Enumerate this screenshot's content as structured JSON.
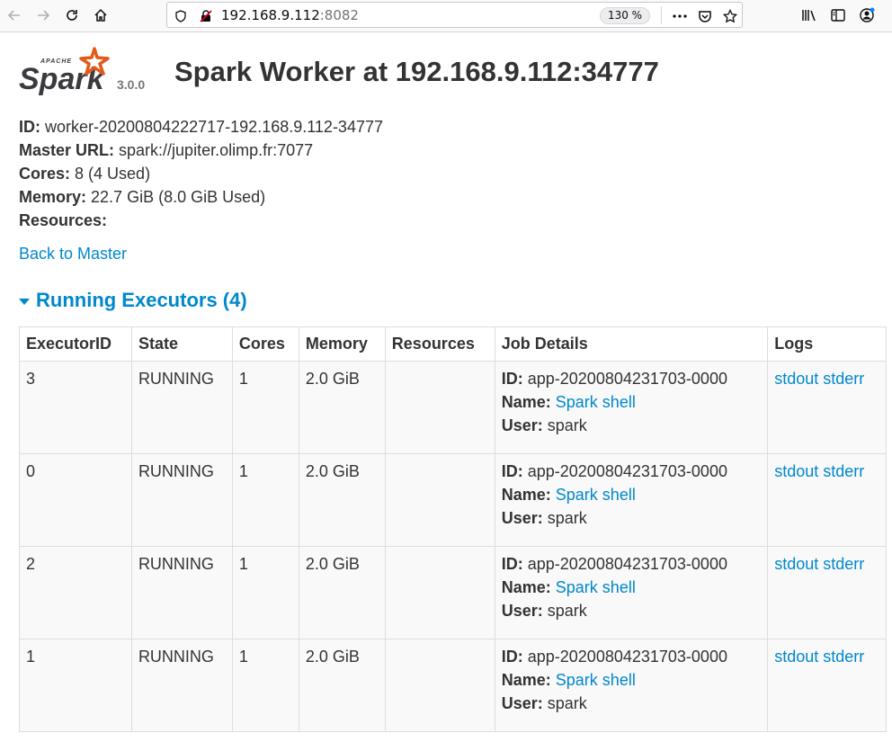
{
  "browser": {
    "url_host": "192.168.9.112",
    "url_port": ":8082",
    "zoom": "130 %"
  },
  "header": {
    "logo_text": "Spark",
    "logo_small": "APACHE",
    "version": "3.0.0",
    "title": "Spark Worker at 192.168.9.112:34777"
  },
  "info": {
    "id_label": "ID:",
    "id_value": "worker-20200804222717-192.168.9.112-34777",
    "master_label": "Master URL:",
    "master_value": "spark://jupiter.olimp.fr:7077",
    "cores_label": "Cores:",
    "cores_value": "8 (4 Used)",
    "memory_label": "Memory:",
    "memory_value": "22.7 GiB (8.0 GiB Used)",
    "resources_label": "Resources:",
    "resources_value": ""
  },
  "back_link": "Back to Master",
  "executors": {
    "header": "Running Executors (4)",
    "columns": [
      "ExecutorID",
      "State",
      "Cores",
      "Memory",
      "Resources",
      "Job Details",
      "Logs"
    ],
    "job_labels": {
      "id": "ID:",
      "name": "Name:",
      "user": "User:"
    },
    "rows": [
      {
        "id": "3",
        "state": "RUNNING",
        "cores": "1",
        "memory": "2.0 GiB",
        "resources": "",
        "app_id": "app-20200804231703-0000",
        "app_name": "Spark shell",
        "user": "spark",
        "stdout": "stdout",
        "stderr": "stderr"
      },
      {
        "id": "0",
        "state": "RUNNING",
        "cores": "1",
        "memory": "2.0 GiB",
        "resources": "",
        "app_id": "app-20200804231703-0000",
        "app_name": "Spark shell",
        "user": "spark",
        "stdout": "stdout",
        "stderr": "stderr"
      },
      {
        "id": "2",
        "state": "RUNNING",
        "cores": "1",
        "memory": "2.0 GiB",
        "resources": "",
        "app_id": "app-20200804231703-0000",
        "app_name": "Spark shell",
        "user": "spark",
        "stdout": "stdout",
        "stderr": "stderr"
      },
      {
        "id": "1",
        "state": "RUNNING",
        "cores": "1",
        "memory": "2.0 GiB",
        "resources": "",
        "app_id": "app-20200804231703-0000",
        "app_name": "Spark shell",
        "user": "spark",
        "stdout": "stdout",
        "stderr": "stderr"
      }
    ]
  },
  "colors": {
    "link": "#0088cc",
    "spark_orange": "#e25a1c",
    "logo_dark": "#3c3a3e"
  }
}
